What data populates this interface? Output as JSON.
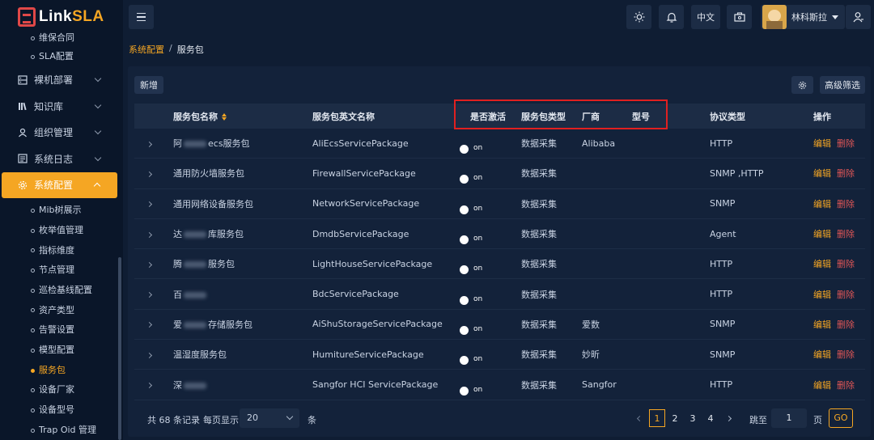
{
  "app": {
    "logo_prefix": "Link",
    "logo_suffix": "SLA"
  },
  "sidebar": {
    "top_items": [
      {
        "label": "维保合同"
      },
      {
        "label": "SLA配置"
      }
    ],
    "groups": [
      {
        "label": "裸机部署",
        "icon": "server-icon"
      },
      {
        "label": "知识库",
        "icon": "books-icon"
      },
      {
        "label": "组织管理",
        "icon": "user-icon"
      },
      {
        "label": "系统日志",
        "icon": "log-icon"
      },
      {
        "label": "系统配置",
        "icon": "gear-icon"
      }
    ],
    "sub_items": [
      {
        "label": "Mib树展示"
      },
      {
        "label": "枚举值管理"
      },
      {
        "label": "指标维度"
      },
      {
        "label": "节点管理"
      },
      {
        "label": "巡检基线配置"
      },
      {
        "label": "资产类型"
      },
      {
        "label": "告警设置"
      },
      {
        "label": "模型配置"
      },
      {
        "label": "服务包"
      },
      {
        "label": "设备厂家"
      },
      {
        "label": "设备型号"
      },
      {
        "label": "Trap Oid 管理"
      }
    ],
    "active_sub": "服务包"
  },
  "header": {
    "lang_label": "中文",
    "username": "林科斯拉",
    "icons": [
      "menu-icon",
      "theme-sun-icon",
      "bell-icon",
      "toolbox-icon",
      "user-icon"
    ]
  },
  "breadcrumb": {
    "parent": "系统配置",
    "sep": "/",
    "current": "服务包"
  },
  "toolbar": {
    "add_label": "新增",
    "advanced_filter_label": "高级筛选"
  },
  "table": {
    "columns": {
      "name": "服务包名称",
      "en_name": "服务包英文名称",
      "active": "是否激活",
      "type": "服务包类型",
      "vendor": "厂商",
      "model": "型号",
      "protocol": "协议类型",
      "actions": "操作"
    },
    "rows": [
      {
        "name_a": "阿",
        "name_b": "ecs服务包",
        "en_name": "AliEcsServicePackage",
        "active": "on",
        "type": "数据采集",
        "vendor": "Alibaba",
        "model": "",
        "protocol": "HTTP"
      },
      {
        "name_a": "通用防火墙服务包",
        "name_b": "",
        "en_name": "FirewallServicePackage",
        "active": "on",
        "type": "数据采集",
        "vendor": "",
        "model": "",
        "protocol": "SNMP ,HTTP"
      },
      {
        "name_a": "通用网络设备服务包",
        "name_b": "",
        "en_name": "NetworkServicePackage",
        "active": "on",
        "type": "数据采集",
        "vendor": "",
        "model": "",
        "protocol": "SNMP"
      },
      {
        "name_a": "达",
        "name_b": "库服务包",
        "en_name": "DmdbServicePackage",
        "active": "on",
        "type": "数据采集",
        "vendor": "",
        "model": "",
        "protocol": "Agent"
      },
      {
        "name_a": "腾",
        "name_b": "服务包",
        "en_name": "LightHouseServicePackage",
        "active": "on",
        "type": "数据采集",
        "vendor": "",
        "model": "",
        "protocol": "HTTP"
      },
      {
        "name_a": "百",
        "name_b": "",
        "en_name": "BdcServicePackage",
        "active": "on",
        "type": "数据采集",
        "vendor": "",
        "model": "",
        "protocol": "HTTP"
      },
      {
        "name_a": "爱",
        "name_b": "存储服务包",
        "en_name": "AiShuStorageServicePackage",
        "active": "on",
        "type": "数据采集",
        "vendor": "爱数",
        "model": "",
        "protocol": "SNMP"
      },
      {
        "name_a": "温湿度服务包",
        "name_b": "",
        "en_name": "HumitureServicePackage",
        "active": "on",
        "type": "数据采集",
        "vendor": "妙昕",
        "model": "",
        "protocol": "SNMP"
      },
      {
        "name_a": "深",
        "name_b": "",
        "en_name": "Sangfor HCI ServicePackage",
        "active": "on",
        "type": "数据采集",
        "vendor": "Sangfor",
        "model": "",
        "protocol": "HTTP"
      }
    ],
    "edit_label": "编辑",
    "delete_label": "删除"
  },
  "pagination": {
    "total_text": "共 68 条记录",
    "page_size_label": "每页显示",
    "page_size": "20",
    "page_size_unit": "条",
    "pages": [
      "1",
      "2",
      "3",
      "4"
    ],
    "current_page": "1",
    "jump_label": "跳至",
    "jump_value": "1",
    "page_unit": "页",
    "go_label": "GO"
  },
  "colors": {
    "accent": "#f5a623",
    "danger": "#e05656",
    "highlight_box": "#e02020",
    "bg": "#0f1d33"
  }
}
